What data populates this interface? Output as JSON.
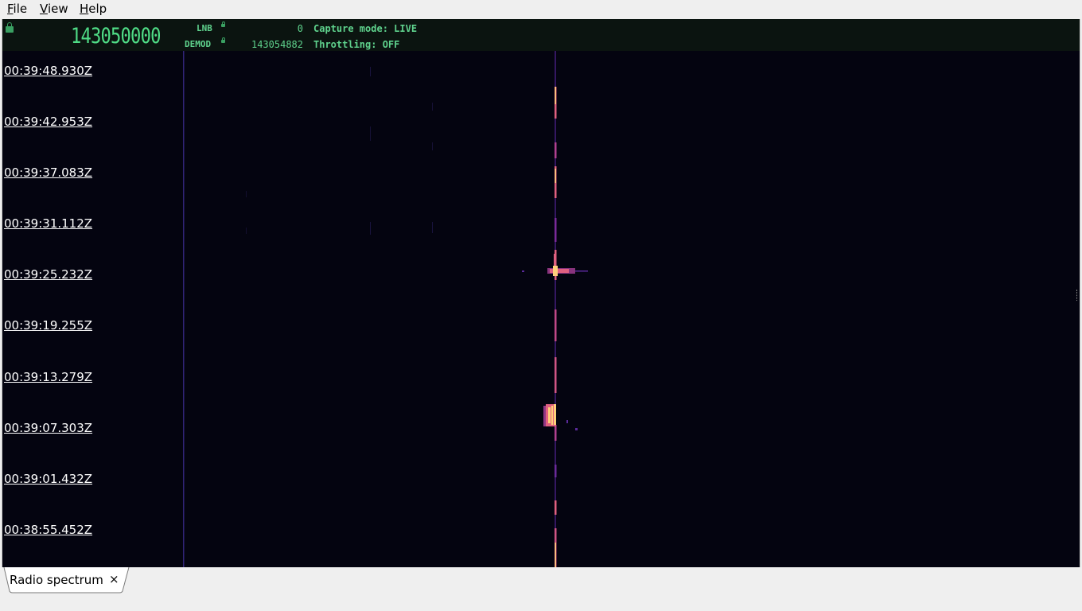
{
  "menu": {
    "file": {
      "accel": "F",
      "rest": "ile"
    },
    "view": {
      "accel": "V",
      "rest": "iew"
    },
    "help": {
      "accel": "H",
      "rest": "elp"
    }
  },
  "status": {
    "main_frequency": "143050000",
    "lnb_label": "LNB",
    "lnb_value": "0",
    "demod_label": "DEMOD",
    "demod_value": "143054882",
    "capture_mode": "Capture mode: LIVE",
    "throttling": "Throttling: OFF"
  },
  "timestamps": [
    "00:39:48.930Z",
    "00:39:42.953Z",
    "00:39:37.083Z",
    "00:39:31.112Z",
    "00:39:25.232Z",
    "00:39:19.255Z",
    "00:39:13.279Z",
    "00:39:07.303Z",
    "00:39:01.432Z",
    "00:38:55.452Z"
  ],
  "tabs": [
    {
      "label": "Radio spectrum",
      "close": "×"
    }
  ],
  "colors": {
    "waterfall_bg": "#040410",
    "status_text": "#5fd28d",
    "signal_hot": "#ffd08a",
    "signal_warm": "#e0608a",
    "signal_cool": "#5a2a9a"
  }
}
